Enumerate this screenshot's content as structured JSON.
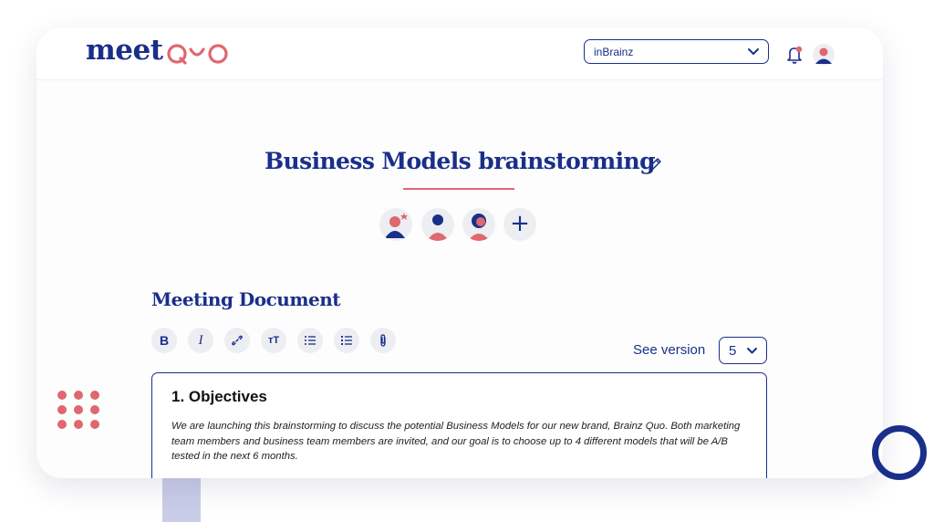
{
  "header": {
    "logo_text": "meet",
    "logo_accent": "QUO",
    "org_selector": {
      "value": "inBrainz"
    }
  },
  "meeting": {
    "title": "Business Models brainstorming",
    "participants": [
      "host-avatar",
      "participant-avatar",
      "participant-avatar"
    ],
    "add_participant_label": "+"
  },
  "document": {
    "heading": "Meeting Document",
    "toolbar": {
      "bold_label": "B",
      "italic_label": "I",
      "text_size_label": "тT"
    },
    "see_version_label": "See version",
    "version_value": "5",
    "content": {
      "section_title": "1. Objectives",
      "body": "We are launching this brainstorming to discuss the potential Business Models for our new brand, Brainz Quo. Both marketing team members and business team members are invited, and our goal is to choose up to 4 different models that will be A/B tested in the next 6 months."
    }
  },
  "colors": {
    "brand_navy": "#1a2f8a",
    "accent_coral": "#e0676f",
    "chip_bg": "#eceef2"
  },
  "icons": {
    "org_chevron": "chevron-down-icon",
    "bell": "bell-icon",
    "edit": "pencil-icon",
    "link": "link-icon",
    "bullet_list": "bullet-list-icon",
    "numbered_list": "numbered-list-icon",
    "attachment": "paperclip-icon"
  },
  "background_number": "1"
}
